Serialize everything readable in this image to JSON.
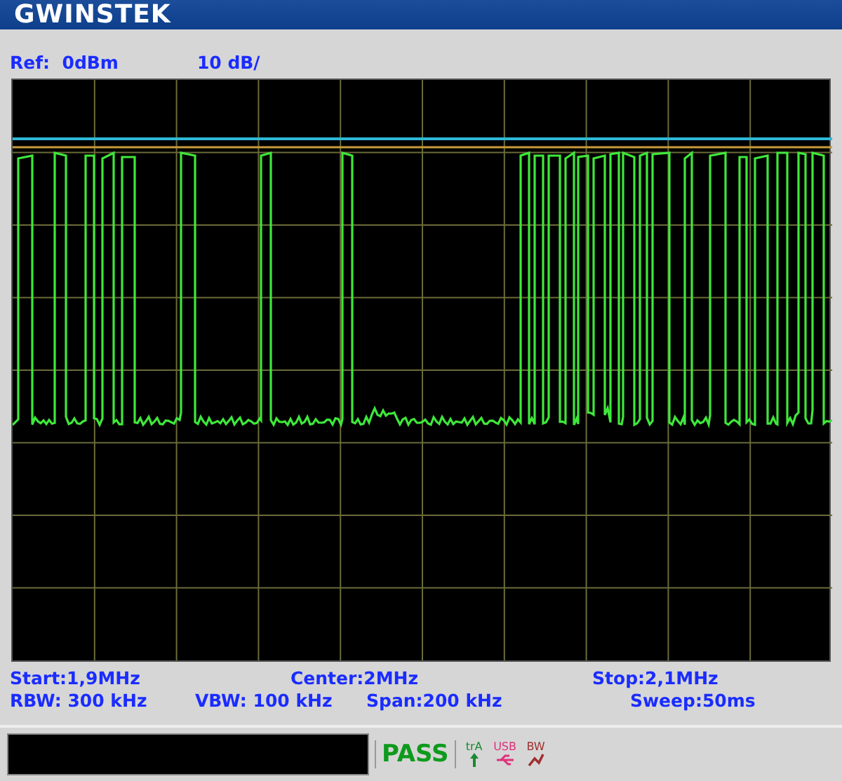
{
  "header": {
    "logo": "GWINSTEK"
  },
  "reference": {
    "ref_level": "Ref:  0dBm",
    "scale": "10 dB/"
  },
  "settings_row_1": [
    "Start:1,9MHz",
    "Center:2MHz",
    "Stop:2,1MHz"
  ],
  "settings_row_2": [
    "RBW: 300 kHz",
    "VBW: 100 kHz",
    "Span:200 kHz",
    "Sweep:50ms"
  ],
  "status_bar": {
    "result": "PASS",
    "indicators": [
      {
        "kind": "trigger",
        "label": "trA"
      },
      {
        "kind": "usb",
        "label": "USB"
      },
      {
        "kind": "bw",
        "label": "BW"
      }
    ]
  }
}
